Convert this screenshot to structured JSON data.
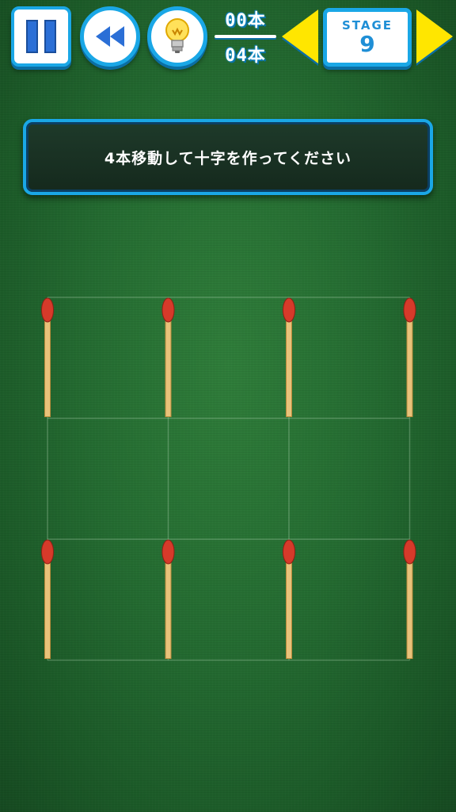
{
  "toolbar": {
    "pause": "pause-icon",
    "rewind": "rewind-icon",
    "hint": "light-bulb-icon"
  },
  "counter": {
    "moved": "00本",
    "limit": "04本"
  },
  "stage": {
    "label": "STAGE",
    "number": "9"
  },
  "instruction": "4本移動して十字を作ってください",
  "board": {
    "grid_cols": 3,
    "grid_rows": 3,
    "matches": [
      {
        "orientation": "vertical",
        "col": 0,
        "row": 0
      },
      {
        "orientation": "vertical",
        "col": 1,
        "row": 0
      },
      {
        "orientation": "vertical",
        "col": 2,
        "row": 0
      },
      {
        "orientation": "vertical",
        "col": 3,
        "row": 0
      },
      {
        "orientation": "vertical",
        "col": 0,
        "row": 2
      },
      {
        "orientation": "vertical",
        "col": 1,
        "row": 2
      },
      {
        "orientation": "vertical",
        "col": 2,
        "row": 2
      },
      {
        "orientation": "vertical",
        "col": 3,
        "row": 2
      }
    ]
  },
  "colors": {
    "accent_blue": "#1aa7e6",
    "arrow_yellow": "#ffe600",
    "felt_green": "#246b31",
    "match_head": "#d63a2a",
    "match_stick": "#e8c27a"
  }
}
